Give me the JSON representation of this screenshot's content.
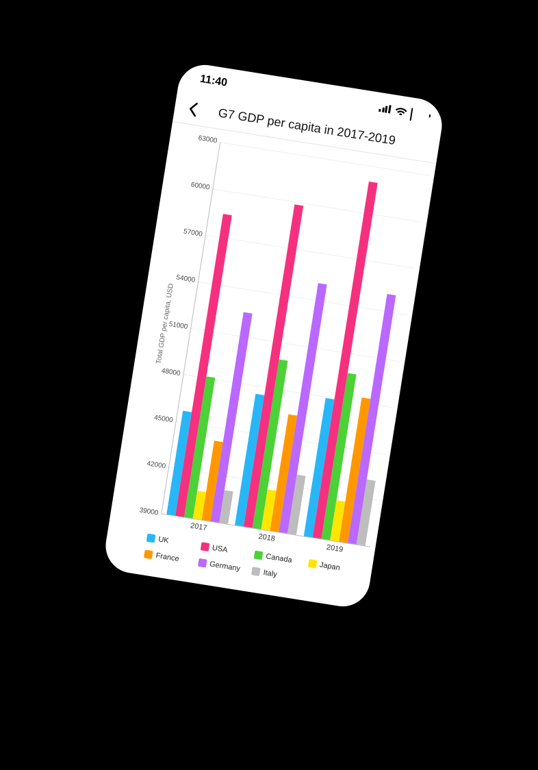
{
  "statusbar": {
    "time": "11:40"
  },
  "header": {
    "title": "G7 GDP per capita in 2017-2019"
  },
  "chart_data": {
    "type": "bar",
    "title": "G7 GDP per capita in 2017-2019",
    "xlabel": "",
    "ylabel": "Total GDP per capita, USD",
    "ylim": [
      39000,
      63000
    ],
    "yticks": [
      63000,
      60000,
      57000,
      54000,
      51000,
      48000,
      45000,
      42000,
      39000
    ],
    "categories": [
      "2017",
      "2018",
      "2019"
    ],
    "series": [
      {
        "name": "UK",
        "color": "#29b6f6",
        "values": [
          45700,
          47500,
          47900
        ]
      },
      {
        "name": "USA",
        "color": "#f5317f",
        "values": [
          58500,
          59800,
          62000
        ]
      },
      {
        "name": "Canada",
        "color": "#4cd137",
        "values": [
          48100,
          49900,
          49700
        ]
      },
      {
        "name": "Japan",
        "color": "#ffe600",
        "values": [
          40800,
          41600,
          41600
        ]
      },
      {
        "name": "France",
        "color": "#ff9800",
        "values": [
          44100,
          46500,
          48300
        ]
      },
      {
        "name": "Germany",
        "color": "#ba68ff",
        "values": [
          52500,
          55100,
          55100
        ]
      },
      {
        "name": "Italy",
        "color": "#bdbdbd",
        "values": [
          41100,
          42800,
          43200
        ]
      }
    ]
  }
}
